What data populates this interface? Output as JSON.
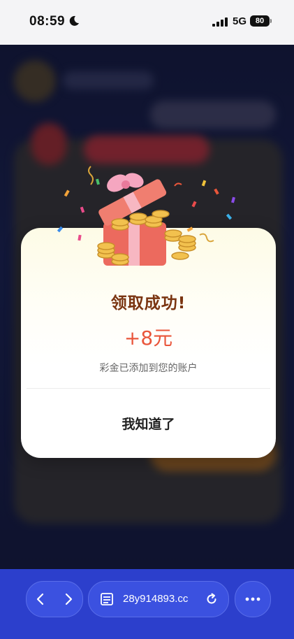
{
  "status_bar": {
    "time": "08:59",
    "network": "5G",
    "battery": "80"
  },
  "modal": {
    "title": "领取成功!",
    "amount": "+8元",
    "description": "彩金已添加到您的账户",
    "confirm_label": "我知道了"
  },
  "browser": {
    "url": "28y914893.cc",
    "icons": [
      "back-icon",
      "forward-icon",
      "site-info-icon",
      "reload-icon",
      "more-icon"
    ]
  },
  "colors": {
    "title": "#7a3410",
    "amount": "#e9553a",
    "browser_bar": "#2c3fcc"
  }
}
